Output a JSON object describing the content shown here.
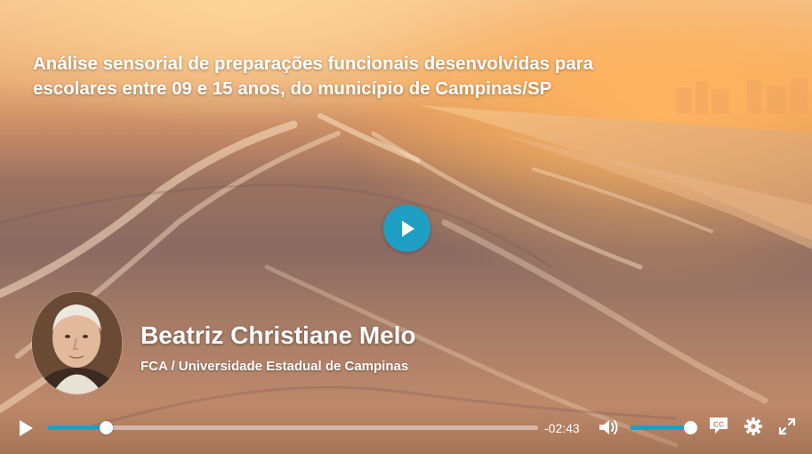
{
  "video": {
    "title": "Análise sensorial de preparações funcionais desenvolvidas para escolares entre 09 e 15 anos, do município de Campinas/SP"
  },
  "speaker": {
    "name": "Beatriz Christiane Melo",
    "institution": "FCA / Universidade Estadual de Campinas"
  },
  "controls": {
    "time_remaining": "-02:43",
    "progress_fraction": 0.12,
    "volume_fraction": 1.0,
    "icons": [
      "play-icon",
      "volume-icon",
      "closed-captions-icon",
      "gear-icon",
      "fullscreen-icon"
    ]
  },
  "colors": {
    "accent": "#1f9fc4",
    "text": "#ffffff"
  }
}
